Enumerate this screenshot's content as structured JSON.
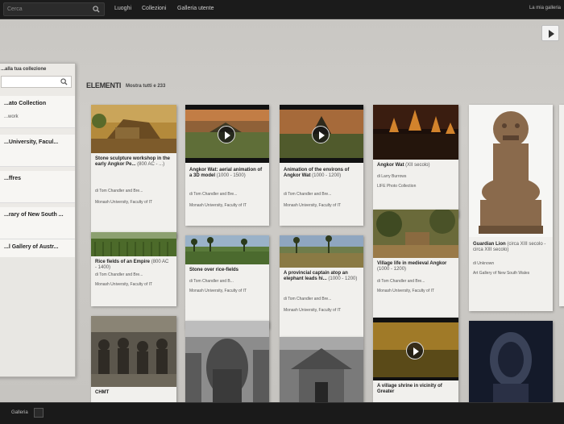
{
  "topbar": {
    "search_placeholder": "Cerca",
    "nav": [
      "Luoghi",
      "Collezioni",
      "Galleria utente"
    ],
    "my_gallery": "La mia galleria"
  },
  "left_panel": {
    "header": "...alla tua collezione",
    "items": [
      {
        "title": "...ato Collection",
        "subtitle": "...work"
      },
      {
        "title": "...University, Facul...",
        "subtitle": ""
      },
      {
        "title": "...ffres",
        "subtitle": ""
      },
      {
        "title": "...rary of New South ...",
        "subtitle": ""
      },
      {
        "title": "...l Gallery of Austr...",
        "subtitle": ""
      }
    ]
  },
  "section": {
    "title": "ELEMENTI",
    "count": "Mostra tutti e 233"
  },
  "cards": [
    {
      "title": "Stone sculpture workshop in the early Angkor Pe...",
      "date": "(800 AC - ...)",
      "author": "di Tom Chandler and Bre...",
      "source": "Monash University, Faculty of IT"
    },
    {
      "title": "Angkor Wat: aerial animation of a 3D model",
      "date": "(1000 - 1500)",
      "author": "di Tom Chandler and Bre...",
      "source": "Monash University, Faculty of IT"
    },
    {
      "title": "Animation of the environs of Angkor Wat",
      "date": "(1000 - 1200)",
      "author": "di Tom Chandler and Bre...",
      "source": "Monash University, Faculty of IT"
    },
    {
      "title": "Angkor Wat",
      "date": "(XII secolo)",
      "author": "di Larry Burrows",
      "source": "LIFE Photo Collection"
    },
    {
      "title": "Guardian Lion",
      "date": "(circa XIII secolo - circa XIII secolo)",
      "author": "di Unknown",
      "source": "Art Gallery of New South Wales"
    },
    {
      "title": "Rice fields of an Empire",
      "date": "(800 AC - 1400)",
      "author": "di Tom Chandler and Bre...",
      "source": "Monash University, Faculty of IT"
    },
    {
      "title": "Stone over rice-fields",
      "date": "",
      "author": "di Tom Chandler and B...",
      "source": "Monash University, Faculty of IT"
    },
    {
      "title": "A provincial captain atop an elephant leads hi...",
      "date": "(1000 - 1200)",
      "author": "di Tom Chandler and Bre...",
      "source": "Monash University, Faculty of IT"
    },
    {
      "title": "Village life in medieval Angkor",
      "date": "(1000 - 1200)",
      "author": "di Tom Chandler and Bre...",
      "source": "Monash University, Faculty of IT"
    },
    {
      "title": "CHMT",
      "date": "",
      "author": "",
      "source": ""
    },
    {
      "title": "A village shrine in vicinity of Greater",
      "date": "",
      "author": "",
      "source": ""
    }
  ],
  "bottombar": {
    "label": "Galleria"
  }
}
